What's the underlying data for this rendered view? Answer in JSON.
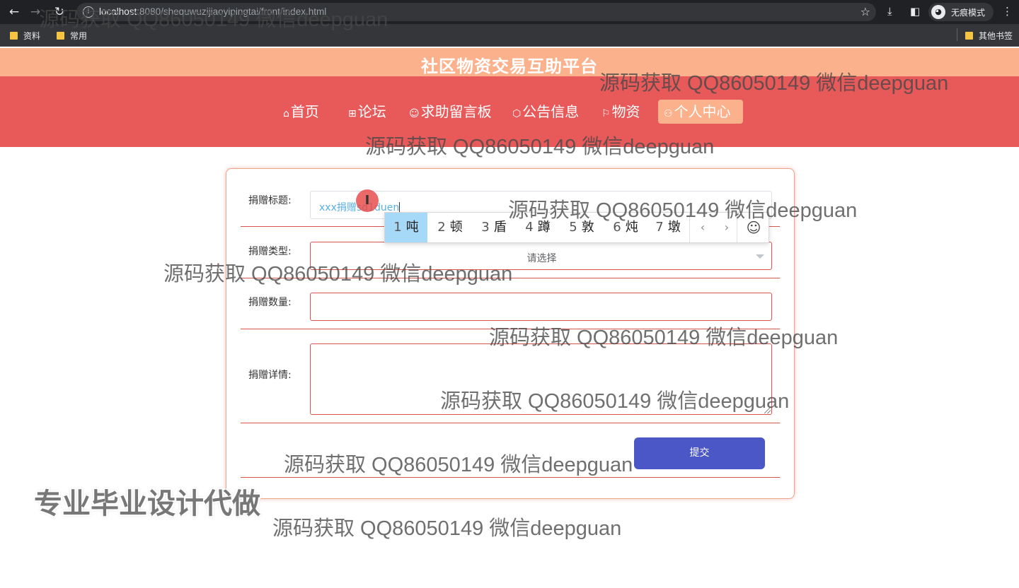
{
  "browser": {
    "url_host": "localhost",
    "url_rest": ":8080/shequwuzijiaoyipingtai/front/index.html",
    "incognito_label": "无痕模式",
    "bookmarks": [
      "资料",
      "常用"
    ],
    "other_bookmarks": "其他书签"
  },
  "site": {
    "title": "社区物资交易互助平台",
    "nav": [
      {
        "icon": "⌂",
        "label": "首页"
      },
      {
        "icon": "⊞",
        "label": "论坛"
      },
      {
        "icon": "☺",
        "label": "求助留言板"
      },
      {
        "icon": "⬡",
        "label": "公告信息"
      },
      {
        "icon": "⚐",
        "label": "物资"
      },
      {
        "icon": "⚇",
        "label": "个人中心"
      }
    ]
  },
  "form": {
    "title_label": "捐赠标题:",
    "title_value": "xxx捐赠sd1duen",
    "type_label": "捐赠类型:",
    "type_placeholder": "请选择",
    "qty_label": "捐赠数量:",
    "detail_label": "捐赠详情:",
    "submit_label": "提交"
  },
  "ime": {
    "candidates": [
      {
        "num": "1",
        "char": "吨"
      },
      {
        "num": "2",
        "char": "顿"
      },
      {
        "num": "3",
        "char": "盾"
      },
      {
        "num": "4",
        "char": "蹲"
      },
      {
        "num": "5",
        "char": "敦"
      },
      {
        "num": "6",
        "char": "炖"
      },
      {
        "num": "7",
        "char": "墩"
      }
    ],
    "prev": "‹",
    "next": "›",
    "emoji": "☺"
  },
  "overlay": {
    "watermark": "源码获取 QQ86050149 微信deepguan",
    "slogan": "专业毕业设计代做"
  }
}
